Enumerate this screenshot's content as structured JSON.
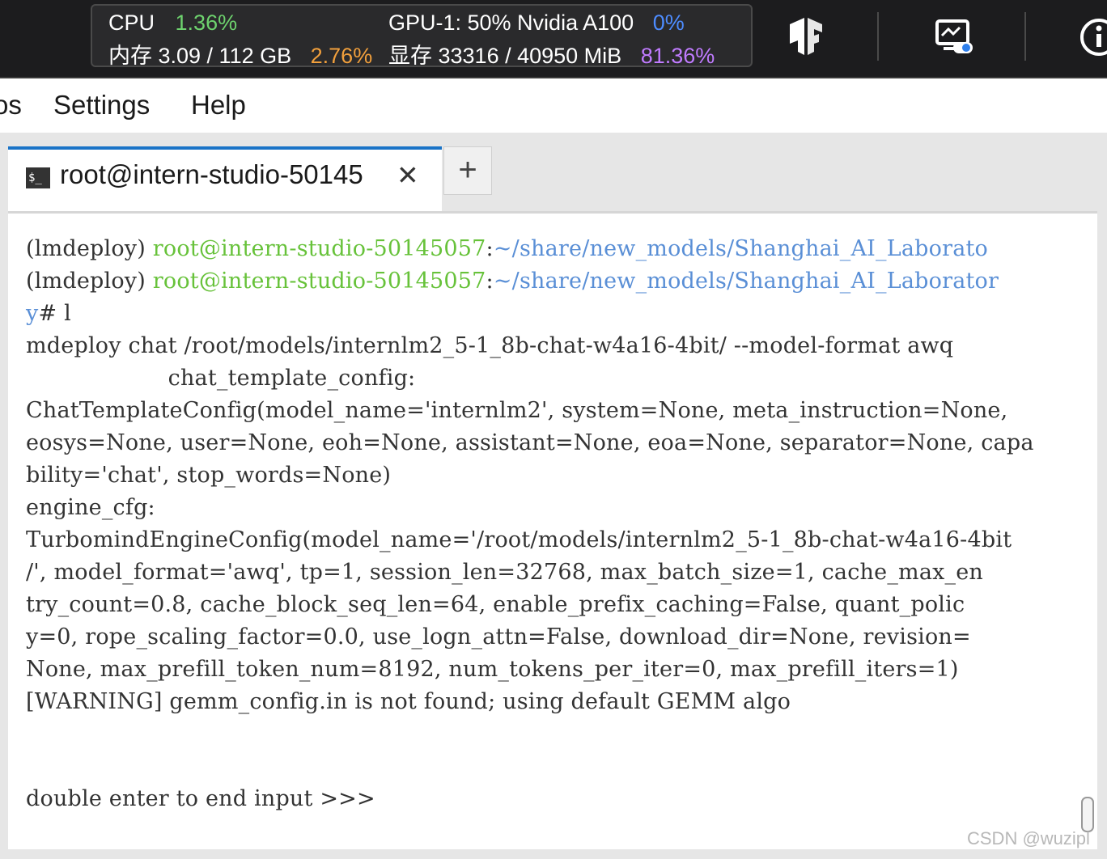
{
  "topbar": {
    "cpu_label": "CPU",
    "cpu_value": "1.36%",
    "mem_label": "内存 3.09 / 112 GB",
    "mem_value": "2.76%",
    "gpu_label": "GPU-1: 50% Nvidia A100",
    "gpu_value": "0%",
    "vram_label": "显存 33316 / 40950 MiB",
    "vram_value": "81.36%",
    "icons": [
      "tensorflow-icon",
      "monitor-settings-icon",
      "info-icon"
    ]
  },
  "menubar": {
    "items": [
      "os",
      "Settings",
      "Help"
    ]
  },
  "tabs": {
    "active_title": "root@intern-studio-50145",
    "close_glyph": "✕",
    "add_glyph": "+",
    "icon_text": "$_"
  },
  "terminal": {
    "line1_prefix": "(lmdeploy) ",
    "line1_user": "root@intern-studio-50145057",
    "line1_colon": ":",
    "line1_path": "~/share/new_models/Shanghai_AI_Laborato",
    "line2_prefix": "(lmdeploy) ",
    "line2_user": "root@intern-studio-50145057",
    "line2_colon": ":",
    "line2_path": "~/share/new_models/Shanghai_AI_Laborator",
    "line3_path": "y",
    "line3_rest": "# l",
    "lines": [
      "mdeploy chat /root/models/internlm2_5-1_8b-chat-w4a16-4bit/ --model-format awq",
      "                    chat_template_config:",
      "ChatTemplateConfig(model_name='internlm2', system=None, meta_instruction=None,",
      "eosys=None, user=None, eoh=None, assistant=None, eoa=None, separator=None, capa",
      "bility='chat', stop_words=None)",
      "engine_cfg:",
      "TurbomindEngineConfig(model_name='/root/models/internlm2_5-1_8b-chat-w4a16-4bit",
      "/', model_format='awq', tp=1, session_len=32768, max_batch_size=1, cache_max_en",
      "try_count=0.8, cache_block_seq_len=64, enable_prefix_caching=False, quant_polic",
      "y=0, rope_scaling_factor=0.0, use_logn_attn=False, download_dir=None, revision=",
      "None, max_prefill_token_num=8192, num_tokens_per_iter=0, max_prefill_iters=1)",
      "[WARNING] gemm_config.in is not found; using default GEMM algo"
    ],
    "prompt": "double enter to end input >>>"
  },
  "watermark": "CSDN @wuzipl"
}
